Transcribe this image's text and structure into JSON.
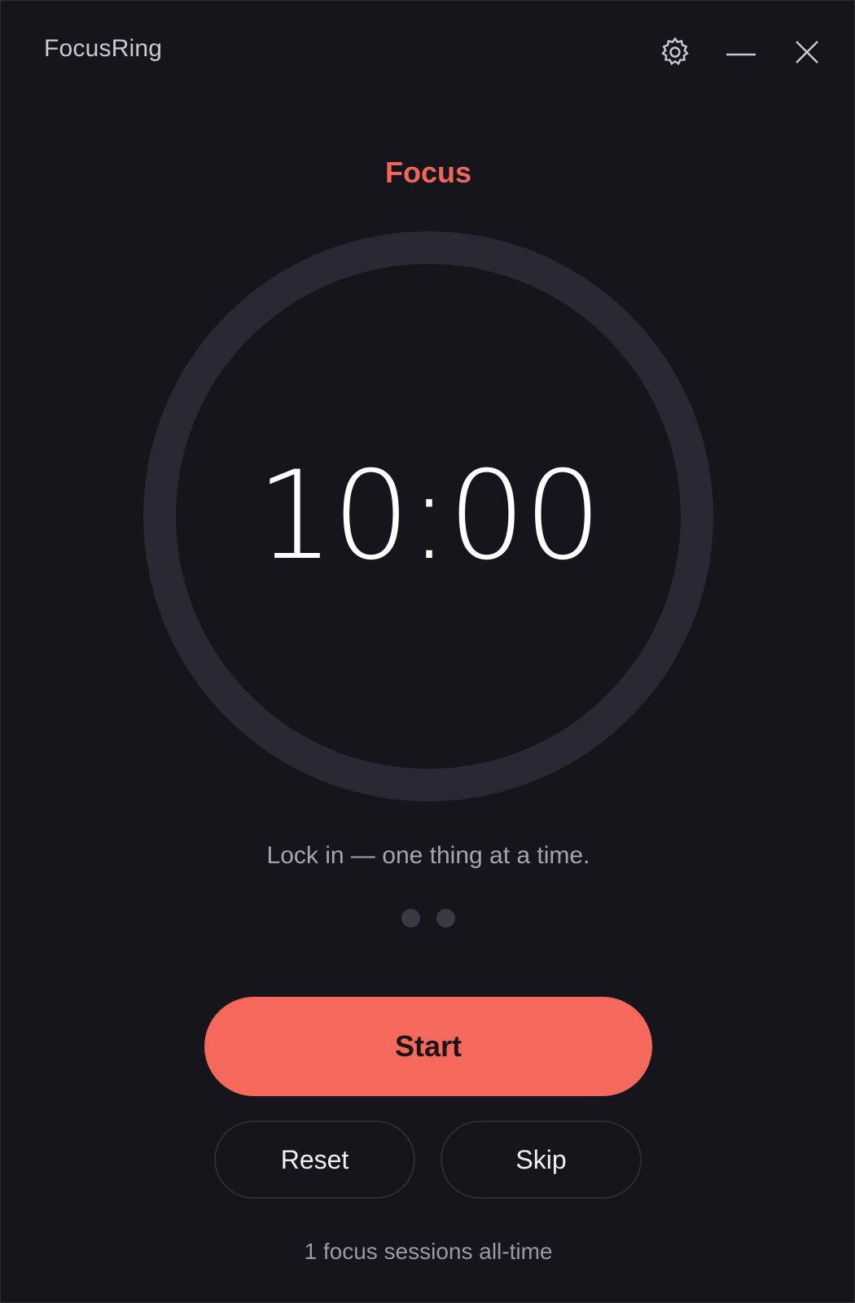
{
  "window": {
    "title": "FocusRing",
    "controls": {
      "settings_icon": "gear-icon",
      "minimize_icon": "minimize-icon",
      "close_icon": "close-icon"
    }
  },
  "timer": {
    "mode": "Focus",
    "time": "10:00",
    "progress": 0,
    "tagline": "Lock in — one thing at a time.",
    "session_dots": 2
  },
  "actions": {
    "start_label": "Start",
    "reset_label": "Reset",
    "skip_label": "Skip"
  },
  "stats": {
    "sessions_text": "1 focus sessions all-time"
  },
  "colors": {
    "accent": "#f5685c",
    "background": "#16151c",
    "ring_track": "#2a2933",
    "dot": "#3a3a45"
  }
}
